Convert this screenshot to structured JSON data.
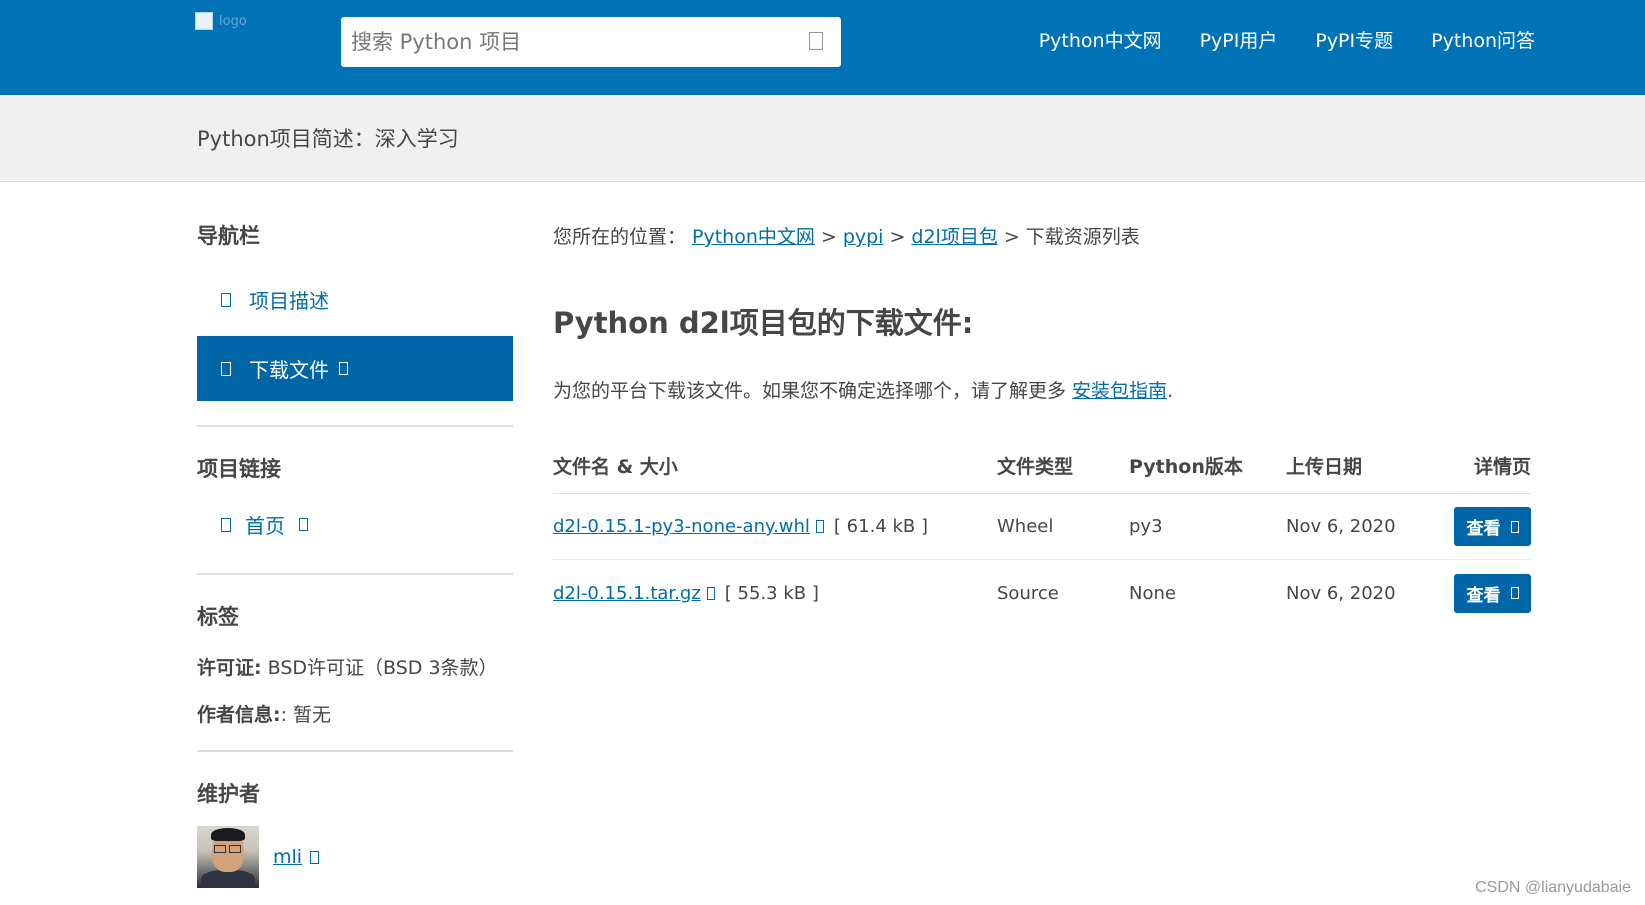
{
  "header": {
    "logo_alt": "logo",
    "search_placeholder": "搜索 Python 项目",
    "nav": [
      "Python中文网",
      "PyPI用户",
      "PyPI专题",
      "Python问答"
    ]
  },
  "titlebar": {
    "title": "Python项目简述：深入学习"
  },
  "sidebar": {
    "nav_heading": "导航栏",
    "nav_items": [
      "项目描述",
      "下载文件"
    ],
    "links_heading": "项目链接",
    "home_link": "首页",
    "tags_heading": "标签",
    "license_label": "许可证:",
    "license_value": " BSD许可证（BSD 3条款）",
    "author_label": "作者信息:",
    "author_value": ": 暂无",
    "maintainers_heading": "维护者",
    "maintainer_name": "mli"
  },
  "main": {
    "breadcrumb_prefix": "您所在的位置：",
    "breadcrumb": [
      "Python中文网",
      "pypi",
      "d2l项目包",
      "下载资源列表"
    ],
    "breadcrumb_sep": ">",
    "heading": "Python d2l项目包的下载文件:",
    "intro_text": "为您的平台下载该文件。如果您不确定选择哪个，请了解更多 ",
    "intro_link": "安装包指南",
    "intro_end": ".",
    "table": {
      "headers": [
        "文件名 & 大小",
        "文件类型",
        "Python版本",
        "上传日期",
        "详情页"
      ],
      "rows": [
        {
          "file": "d2l-0.15.1-py3-none-any.whl",
          "size": "[ 61.4 kB ]",
          "type": "Wheel",
          "python": "py3",
          "date": "Nov 6, 2020",
          "action": "查看"
        },
        {
          "file": "d2l-0.15.1.tar.gz",
          "size": "[ 55.3 kB ]",
          "type": "Source",
          "python": "None",
          "date": "Nov 6, 2020",
          "action": "查看"
        }
      ]
    }
  },
  "watermark": "CSDN @lianyudabaie",
  "colors": {
    "header_bg": "#0073b7",
    "accent": "#0066a8",
    "link": "#006dad",
    "titlebar_bg": "#f0f0f0"
  }
}
